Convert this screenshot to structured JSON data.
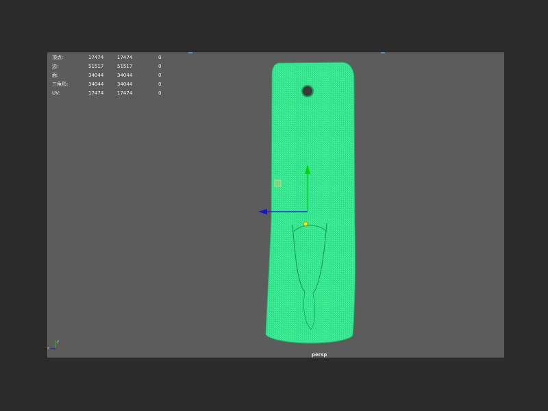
{
  "viewport": {
    "camera_label": "persp"
  },
  "hud": {
    "rows": [
      {
        "label": "顶点:",
        "v1": "17474",
        "v2": "17474",
        "v3": "0"
      },
      {
        "label": "边:",
        "v1": "51517",
        "v2": "51517",
        "v3": "0"
      },
      {
        "label": "面:",
        "v1": "34044",
        "v2": "34044",
        "v3": "0"
      },
      {
        "label": "三角形:",
        "v1": "34044",
        "v2": "34044",
        "v3": "0"
      },
      {
        "label": "UV:",
        "v1": "17474",
        "v2": "17474",
        "v3": "0"
      }
    ]
  },
  "colors": {
    "viewport_bg": "#5c5c5c",
    "mesh_fill": "#3ff49a",
    "mesh_wire": "#1fb86b",
    "move_y_axis": "#00d800",
    "move_x_axis": "#1414d8",
    "pivot": "#f2e600"
  },
  "icons": {
    "axis_indicator": "axis-triad-icon",
    "manipulator": "move-tool-manipulator-icon"
  }
}
